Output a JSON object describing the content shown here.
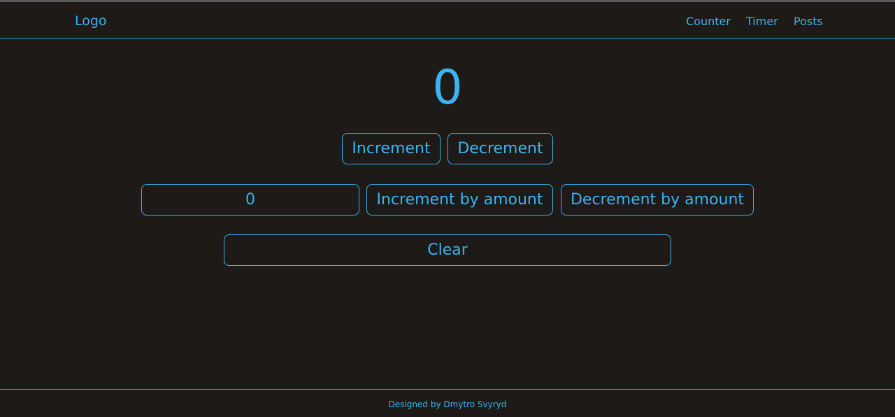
{
  "header": {
    "logo": "Logo",
    "nav": [
      {
        "label": "Counter"
      },
      {
        "label": "Timer"
      },
      {
        "label": "Posts"
      }
    ]
  },
  "counter": {
    "value": "0",
    "increment_label": "Increment",
    "decrement_label": "Decrement",
    "amount_value": "0",
    "increment_by_amount_label": "Increment by amount",
    "decrement_by_amount_label": "Decrement by amount",
    "clear_label": "Clear"
  },
  "footer": {
    "credit": "Designed by Dmytro Svyryd"
  },
  "colors": {
    "background": "#1d1a17",
    "accent": "#3ab4f2"
  }
}
